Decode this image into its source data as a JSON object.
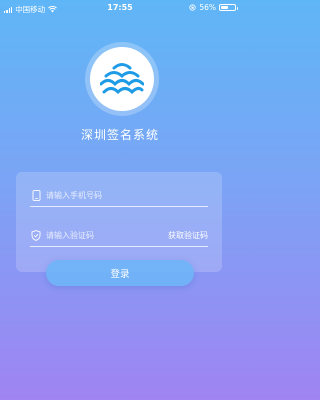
{
  "status_bar": {
    "carrier": "中国移动",
    "time": "17:55",
    "battery_percent": "56%",
    "battery_level": 0.56
  },
  "app": {
    "title": "深圳签名系统",
    "logo_icon": "wave-logo-icon"
  },
  "form": {
    "phone_placeholder": "请输入手机号码",
    "phone_value": "",
    "code_placeholder": "请输入验证码",
    "code_value": "",
    "get_code_label": "获取验证码",
    "login_label": "登录"
  },
  "colors": {
    "accent": "#1e9be6",
    "background_top": "#5fb6f7",
    "background_bottom": "#9f84f2"
  }
}
